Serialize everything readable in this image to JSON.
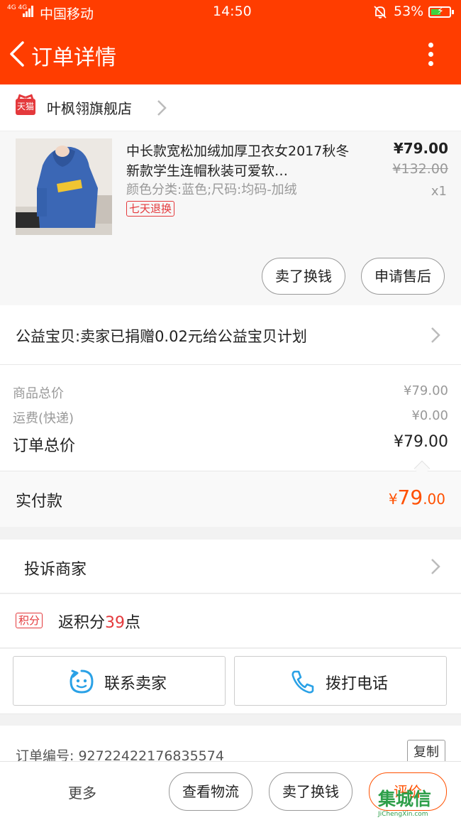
{
  "status_bar": {
    "network": "4G 4G",
    "carrier": "中国移动",
    "time": "14:50",
    "battery": "53%",
    "battery_level": 0.53
  },
  "header": {
    "title": "订单详情"
  },
  "shop": {
    "badge": "天猫",
    "name": "叶枫翎旗舰店"
  },
  "product": {
    "title": "中长款宽松加绒加厚卫衣女2017秋冬新款学生连帽秋装可爱软…",
    "spec": "颜色分类:蓝色;尺码:均码-加绒",
    "tag": "七天退换",
    "price": "¥79.00",
    "original_price": "¥132.00",
    "quantity": "x1",
    "sell_button": "卖了换钱",
    "after_sale_button": "申请售后"
  },
  "charity": {
    "text": "公益宝贝:卖家已捐赠0.02元给公益宝贝计划"
  },
  "summary": {
    "goods_label": "商品总价",
    "goods_value": "¥79.00",
    "shipping_label": "运费(快递)",
    "shipping_value": "¥0.00",
    "total_label": "订单总价",
    "total_value": "¥79.00"
  },
  "paid": {
    "label": "实付款",
    "symbol": "¥",
    "integer": "79",
    "decimal": ".00"
  },
  "complain": {
    "text": "投诉商家"
  },
  "points": {
    "badge": "积分",
    "prefix": "返积分",
    "number": "39",
    "suffix": "点"
  },
  "contact": {
    "seller": "联系卖家",
    "call": "拨打电话"
  },
  "order": {
    "number_label": "订单编号: 92722422176835574",
    "copy": "复制"
  },
  "bottom": {
    "more": "更多",
    "logistics": "查看物流",
    "sell": "卖了换钱",
    "evaluate": "评价"
  },
  "watermark": {
    "logo": "集城信",
    "url": "JiChengXin.com"
  },
  "colors": {
    "brand": "#ff3d00",
    "accent": "#ff5000",
    "tag_red": "#e4393c"
  }
}
